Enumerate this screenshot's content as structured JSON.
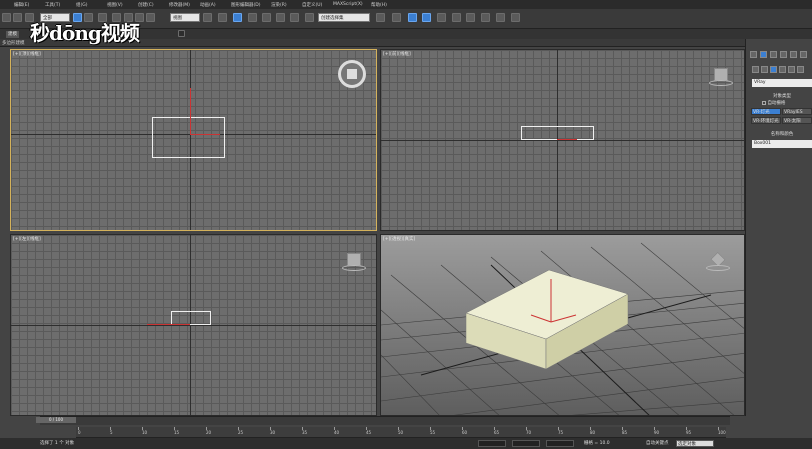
{
  "menubar": {
    "items": [
      "编辑(E)",
      "工具(T)",
      "组(G)",
      "视图(V)",
      "创建(C)",
      "修改器(M)",
      "动画(A)",
      "图形编辑器(D)",
      "渲染(R)",
      "自定义(U)",
      "MAXScript(X)",
      "帮助(H)"
    ]
  },
  "toolbar": {
    "filter_select": "全部",
    "view_select": "视图",
    "selection_set_select": "创建选择集"
  },
  "subbar": {
    "tab_active": "建模",
    "ribbon_label": "多边形建模"
  },
  "watermark": "秒dōng视频",
  "viewports": {
    "top": {
      "label": "[+][顶][线框]"
    },
    "front": {
      "label": "[+][前][线框]"
    },
    "left": {
      "label": "[+][左][线框]"
    },
    "perspective": {
      "label": "[+][透视][真实]"
    }
  },
  "command_panel": {
    "renderer_field": "VRay",
    "object_type_header": "对象类型",
    "auto_grid_label": "自动栅格",
    "buttons": [
      "VR-灯光",
      "VRayIES",
      "VR-环境灯光",
      "VR-太阳"
    ],
    "name_color_header": "名称和颜色",
    "name_field": "Box001"
  },
  "timeline": {
    "slider_label": "0 / 100",
    "ticks": [
      "0",
      "5",
      "10",
      "15",
      "20",
      "25",
      "30",
      "35",
      "40",
      "45",
      "50",
      "55",
      "60",
      "65",
      "70",
      "75",
      "80",
      "85",
      "90",
      "95",
      "100"
    ]
  },
  "statusbar": {
    "selection_text": "选择了 1 个 对象",
    "grid_text": "栅格 = 10.0",
    "auto_key": "自动关键点",
    "selected_object": "选定对象"
  },
  "colors": {
    "active_viewport_border": "#d4b25b",
    "accent_blue": "#3b7fd2",
    "box_fill": "#e6e6c8"
  }
}
